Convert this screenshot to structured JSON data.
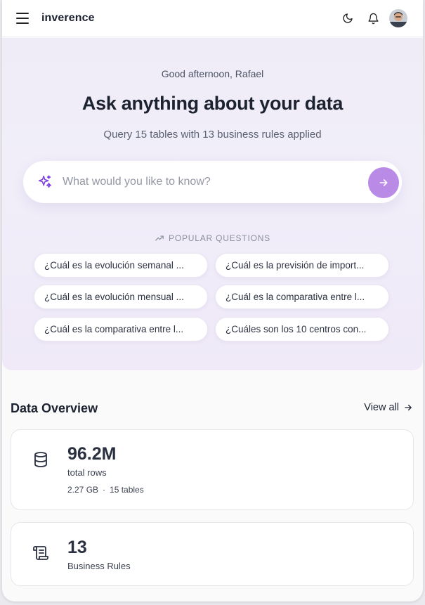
{
  "header": {
    "brand": "inverence",
    "icons": [
      "menu-icon",
      "moon-icon",
      "bell-icon",
      "avatar"
    ]
  },
  "hero": {
    "greeting": "Good afternoon, Rafael",
    "headline": "Ask anything about your data",
    "subline": "Query 15 tables with 13 business rules applied",
    "search": {
      "placeholder": "What would you like to know?",
      "value": ""
    },
    "popular_label": "POPULAR QUESTIONS",
    "questions": [
      "¿Cuál es la evolución semanal ...",
      "¿Cuál es la previsión de import...",
      "¿Cuál es la evolución mensual ...",
      "¿Cuál es la comparativa entre l...",
      "¿Cuál es la comparativa entre l...",
      "¿Cuáles son los 10 centros con..."
    ]
  },
  "overview": {
    "title": "Data Overview",
    "view_all": "View all",
    "cards": [
      {
        "value": "96.2M",
        "label": "total rows",
        "meta_size": "2.27 GB",
        "meta_sep": "·",
        "meta_tables": "15 tables"
      },
      {
        "value": "13",
        "label": "Business Rules"
      }
    ]
  },
  "colors": {
    "accent": "#b98ae6",
    "spark": "#7b3fe4",
    "hero_bg": "#efecf8"
  }
}
